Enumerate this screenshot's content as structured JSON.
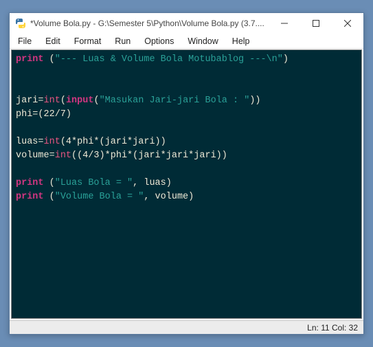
{
  "window": {
    "title": "*Volume Bola.py - G:\\Semester 5\\Python\\Volume Bola.py (3.7...."
  },
  "menubar": {
    "items": [
      "File",
      "Edit",
      "Format",
      "Run",
      "Options",
      "Window",
      "Help"
    ]
  },
  "code": {
    "lines": [
      [
        {
          "cls": "kw-builtin",
          "t": "print"
        },
        {
          "cls": "ident",
          "t": " ("
        },
        {
          "cls": "string",
          "t": "\"--- Luas & Volume Bola Motubablog ---\\n\""
        },
        {
          "cls": "ident",
          "t": ")"
        }
      ],
      [],
      [],
      [
        {
          "cls": "ident",
          "t": "jari="
        },
        {
          "cls": "kw-type",
          "t": "int"
        },
        {
          "cls": "ident",
          "t": "("
        },
        {
          "cls": "kw-builtin",
          "t": "input"
        },
        {
          "cls": "ident",
          "t": "("
        },
        {
          "cls": "string",
          "t": "\"Masukan Jari-jari Bola : \""
        },
        {
          "cls": "ident",
          "t": "))"
        }
      ],
      [
        {
          "cls": "ident",
          "t": "phi=(22/7)"
        }
      ],
      [],
      [
        {
          "cls": "ident",
          "t": "luas="
        },
        {
          "cls": "kw-type",
          "t": "int"
        },
        {
          "cls": "ident",
          "t": "(4*phi*(jari*jari))"
        }
      ],
      [
        {
          "cls": "ident",
          "t": "volume="
        },
        {
          "cls": "kw-type",
          "t": "int"
        },
        {
          "cls": "ident",
          "t": "((4/3)*phi*(jari*jari*jari))"
        }
      ],
      [],
      [
        {
          "cls": "kw-builtin",
          "t": "print"
        },
        {
          "cls": "ident",
          "t": " ("
        },
        {
          "cls": "string",
          "t": "\"Luas Bola = \""
        },
        {
          "cls": "ident",
          "t": ", luas)"
        }
      ],
      [
        {
          "cls": "kw-builtin",
          "t": "print"
        },
        {
          "cls": "ident",
          "t": " ("
        },
        {
          "cls": "string",
          "t": "\"Volume Bola = \""
        },
        {
          "cls": "ident",
          "t": ", volume)"
        }
      ]
    ]
  },
  "statusbar": {
    "position": "Ln: 11  Col: 32"
  }
}
